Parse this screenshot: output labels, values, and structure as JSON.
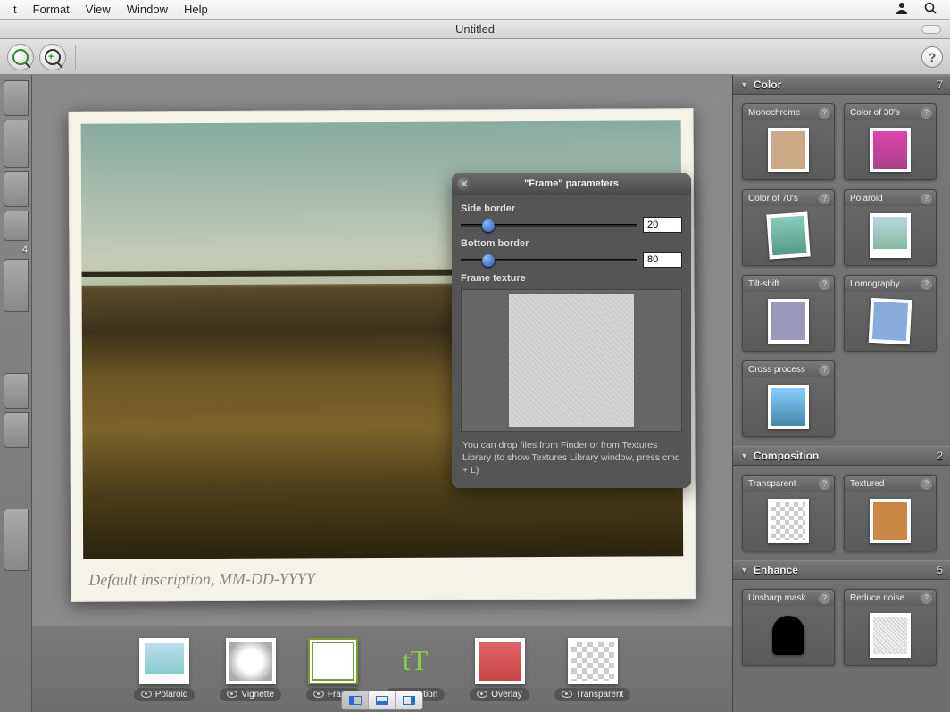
{
  "menubar": {
    "items": [
      "t",
      "Format",
      "View",
      "Window",
      "Help"
    ]
  },
  "title": "Untitled",
  "params": {
    "title": "\"Frame\" parameters",
    "side_border_label": "Side border",
    "side_border_value": "20",
    "bottom_border_label": "Bottom border",
    "bottom_border_value": "80",
    "frame_texture_label": "Frame texture",
    "hint": "You can drop files from Finder or from Textures Library (to show Textures Library window, press cmd + L)"
  },
  "inscription": "Default inscription, MM-DD-YYYY",
  "effects": [
    {
      "label": "Polaroid",
      "kind": "polaroid"
    },
    {
      "label": "Vignette",
      "kind": "vignette"
    },
    {
      "label": "Frame",
      "kind": "frame"
    },
    {
      "label": "Caption",
      "kind": "caption"
    },
    {
      "label": "Overlay",
      "kind": "overlay"
    },
    {
      "label": "Transparent",
      "kind": "transparent"
    }
  ],
  "left_badge": "4",
  "sidebar": {
    "sections": [
      {
        "name": "Color",
        "count": "7",
        "presets": [
          {
            "label": "Monochrome",
            "thumb": "a"
          },
          {
            "label": "Color of 30's",
            "thumb": "c"
          },
          {
            "label": "Color of 70's",
            "thumb": "d"
          },
          {
            "label": "Polaroid",
            "thumb": "b"
          },
          {
            "label": "Tilt-shift",
            "thumb": "e"
          },
          {
            "label": "Lomography",
            "thumb": "f"
          },
          {
            "label": "Cross process",
            "thumb": "g"
          }
        ]
      },
      {
        "name": "Composition",
        "count": "2",
        "presets": [
          {
            "label": "Transparent",
            "thumb": "h"
          },
          {
            "label": "Textured",
            "thumb": "i"
          }
        ]
      },
      {
        "name": "Enhance",
        "count": "5",
        "presets": [
          {
            "label": "Unsharp mask",
            "thumb": "sil"
          },
          {
            "label": "Reduce noise",
            "thumb": "noise"
          }
        ]
      }
    ]
  }
}
